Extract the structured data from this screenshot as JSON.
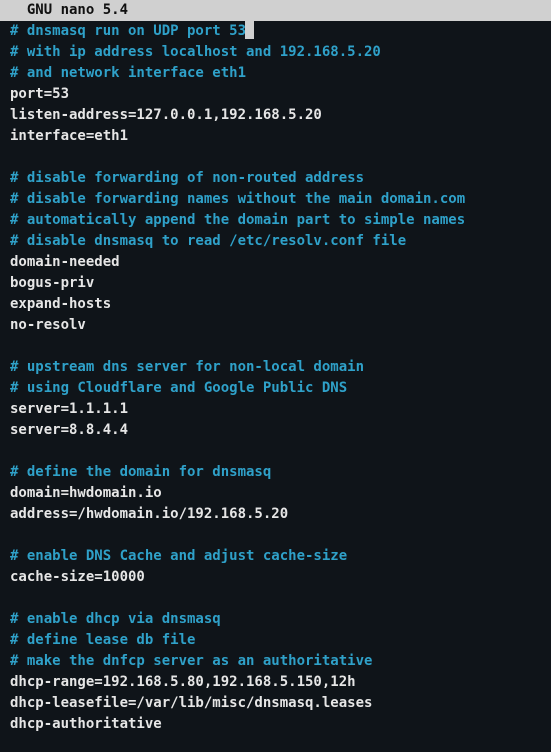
{
  "titlebar": {
    "text": "  GNU nano 5.4"
  },
  "editor": {
    "lines": [
      {
        "style": "comment",
        "text": "# dnsmasq run on UDP port 53",
        "cursor_after": true
      },
      {
        "style": "comment",
        "text": "# with ip address localhost and 192.168.5.20"
      },
      {
        "style": "comment",
        "text": "# and network interface eth1"
      },
      {
        "style": "plain",
        "text": "port=53"
      },
      {
        "style": "plain",
        "text": "listen-address=127.0.0.1,192.168.5.20"
      },
      {
        "style": "plain",
        "text": "interface=eth1"
      },
      {
        "style": "plain",
        "text": ""
      },
      {
        "style": "comment",
        "text": "# disable forwarding of non-routed address"
      },
      {
        "style": "comment",
        "text": "# disable forwarding names without the main domain.com"
      },
      {
        "style": "comment",
        "text": "# automatically append the domain part to simple names"
      },
      {
        "style": "comment",
        "text": "# disable dnsmasq to read /etc/resolv.conf file"
      },
      {
        "style": "plain",
        "text": "domain-needed"
      },
      {
        "style": "plain",
        "text": "bogus-priv"
      },
      {
        "style": "plain",
        "text": "expand-hosts"
      },
      {
        "style": "plain",
        "text": "no-resolv"
      },
      {
        "style": "plain",
        "text": ""
      },
      {
        "style": "comment",
        "text": "# upstream dns server for non-local domain"
      },
      {
        "style": "comment",
        "text": "# using Cloudflare and Google Public DNS"
      },
      {
        "style": "plain",
        "text": "server=1.1.1.1"
      },
      {
        "style": "plain",
        "text": "server=8.8.4.4"
      },
      {
        "style": "plain",
        "text": ""
      },
      {
        "style": "comment",
        "text": "# define the domain for dnsmasq"
      },
      {
        "style": "plain",
        "text": "domain=hwdomain.io"
      },
      {
        "style": "plain",
        "text": "address=/hwdomain.io/192.168.5.20"
      },
      {
        "style": "plain",
        "text": ""
      },
      {
        "style": "comment",
        "text": "# enable DNS Cache and adjust cache-size"
      },
      {
        "style": "plain",
        "text": "cache-size=10000"
      },
      {
        "style": "plain",
        "text": ""
      },
      {
        "style": "comment",
        "text": "# enable dhcp via dnsmasq"
      },
      {
        "style": "comment",
        "text": "# define lease db file"
      },
      {
        "style": "comment",
        "text": "# make the dnfcp server as an authoritative"
      },
      {
        "style": "plain",
        "text": "dhcp-range=192.168.5.80,192.168.5.150,12h"
      },
      {
        "style": "plain",
        "text": "dhcp-leasefile=/var/lib/misc/dnsmasq.leases"
      },
      {
        "style": "plain",
        "text": "dhcp-authoritative"
      }
    ]
  }
}
